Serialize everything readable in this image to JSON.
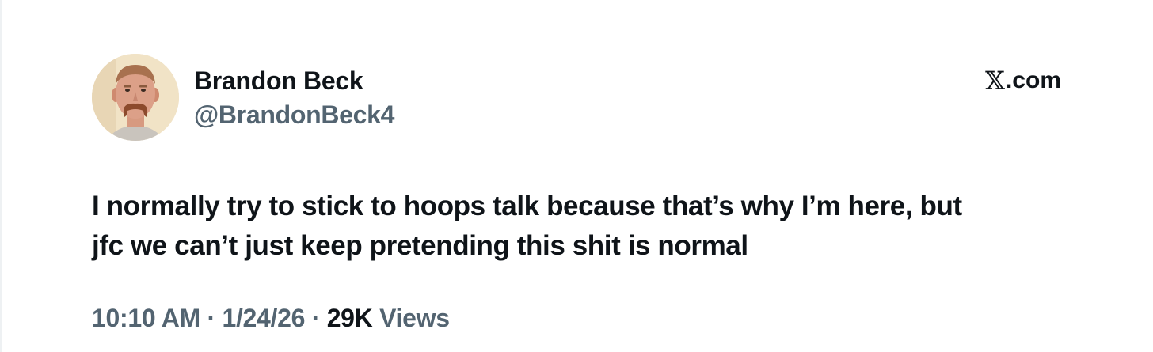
{
  "author": {
    "display_name": "Brandon Beck",
    "handle": "@BrandonBeck4"
  },
  "brand": {
    "icon": "x-logo-icon",
    "label": ".com"
  },
  "tweet": {
    "lines": [
      "I normally try to stick to hoops talk because that’s why I’m here, but",
      "jfc we can’t just keep pretending this shit is normal"
    ]
  },
  "meta": {
    "time": "10:10 AM",
    "separator": "·",
    "date": "1/24/26",
    "views_count": "29K",
    "views_label": "Views"
  },
  "colors": {
    "text_primary": "#0f1419",
    "text_secondary": "#536471",
    "background": "#ffffff"
  }
}
